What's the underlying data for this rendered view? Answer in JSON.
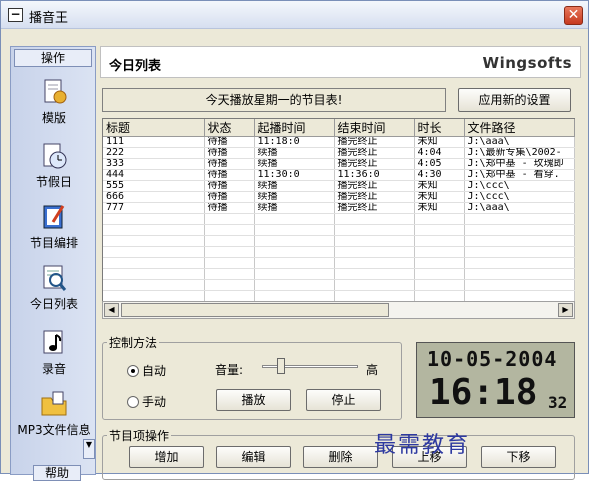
{
  "window": {
    "title": "播音王"
  },
  "sidebar": {
    "header": "操作",
    "items": [
      {
        "label": "模版",
        "icon": "template-icon"
      },
      {
        "label": "节假日",
        "icon": "clock-icon"
      },
      {
        "label": "节目编排",
        "icon": "schedule-edit-icon"
      },
      {
        "label": "今日列表",
        "icon": "today-list-icon"
      },
      {
        "label": "录音",
        "icon": "record-icon"
      },
      {
        "label": "MP3文件信息",
        "icon": "folder-icon"
      }
    ],
    "help": "帮助"
  },
  "header": {
    "title": "今日列表",
    "brand": "Wingsofts"
  },
  "banner": "今天播放星期一的节目表!",
  "apply_button": "应用新的设置",
  "table": {
    "columns": [
      "标题",
      "状态",
      "起播时间",
      "结束时间",
      "时长",
      "文件路径"
    ],
    "rows": [
      [
        "111",
        "待播",
        "11:18:0",
        "播完终止",
        "未知",
        "J:\\aaa\\"
      ],
      [
        "222",
        "待播",
        "续播",
        "播完终止",
        "4:04",
        "J:\\最新专集\\2002-"
      ],
      [
        "333",
        "待播",
        "续播",
        "播完终止",
        "4:05",
        "J:\\郑中基 - 玫瑰即"
      ],
      [
        "444",
        "待播",
        "11:30:0",
        "11:36:0",
        "4:30",
        "J:\\郑中基 - 看穿."
      ],
      [
        "555",
        "待播",
        "续播",
        "播完终止",
        "未知",
        "J:\\ccc\\"
      ],
      [
        "666",
        "待播",
        "续播",
        "播完终止",
        "未知",
        "J:\\ccc\\"
      ],
      [
        "777",
        "待播",
        "续播",
        "播完终止",
        "未知",
        "J:\\aaa\\"
      ]
    ]
  },
  "control": {
    "label": "控制方法",
    "auto": "自动",
    "manual": "手动",
    "volume_label": "音量:",
    "volume_high": "高",
    "volume_level": 0.2,
    "play": "播放",
    "stop": "停止"
  },
  "clock": {
    "date": "10-05-2004",
    "time": "16:18",
    "seconds": "32"
  },
  "program_ops": {
    "label": "节目项操作",
    "buttons": [
      "增加",
      "编辑",
      "删除",
      "上移",
      "下移"
    ]
  },
  "watermark": "最需教育"
}
